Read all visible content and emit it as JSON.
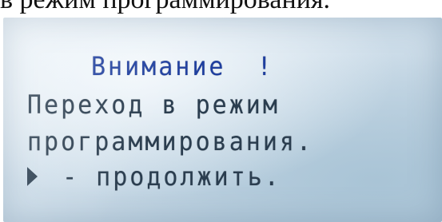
{
  "caption": {
    "text": "в режим программирования."
  },
  "lcd": {
    "title": "Внимание",
    "title_mark": "!",
    "line1": "Переход в режим",
    "line2": "программирования.",
    "line3_arrow_icon": "play-arrow-icon",
    "line3_text": "- продолжить."
  },
  "colors": {
    "title": "#1f3f9f",
    "text": "#2a3d4f",
    "screen_background": "#cddde9"
  }
}
